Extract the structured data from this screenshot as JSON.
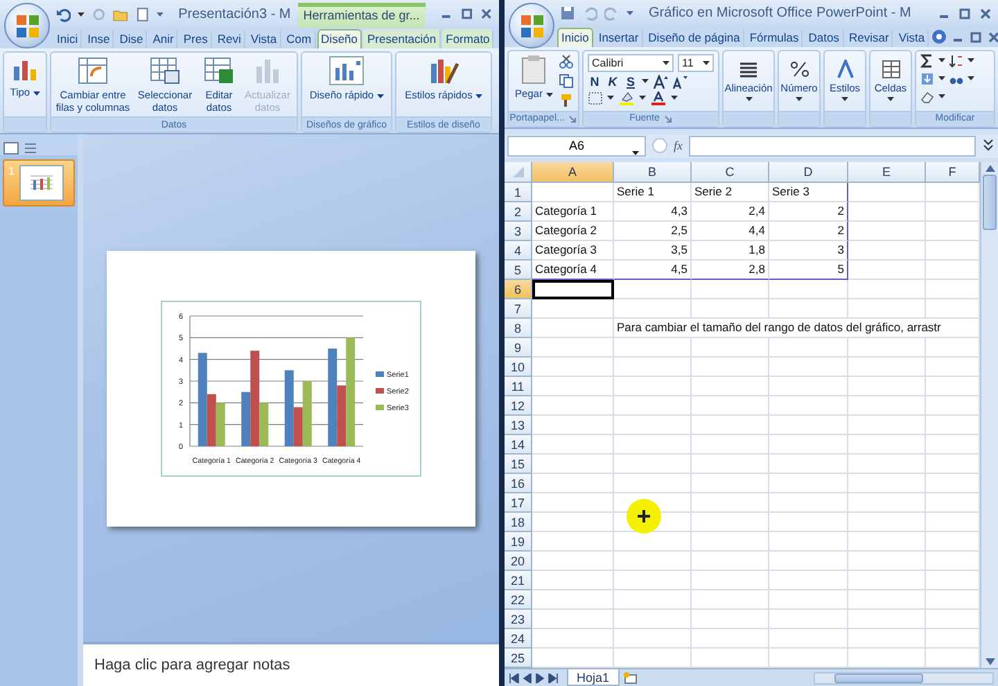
{
  "presentation_window": {
    "title": "Presentación3 - M",
    "context_label": "Herramientas de gr...",
    "tabs": [
      {
        "label": "Inici",
        "selected": false,
        "contextual": false
      },
      {
        "label": "Inse",
        "selected": false,
        "contextual": false
      },
      {
        "label": "Dise",
        "selected": false,
        "contextual": false
      },
      {
        "label": "Anir",
        "selected": false,
        "contextual": false
      },
      {
        "label": "Pres",
        "selected": false,
        "contextual": false
      },
      {
        "label": "Revi",
        "selected": false,
        "contextual": false
      },
      {
        "label": "Vista",
        "selected": false,
        "contextual": false
      },
      {
        "label": "Com",
        "selected": false,
        "contextual": false
      },
      {
        "label": "Diseño",
        "selected": true,
        "contextual": true
      },
      {
        "label": "Presentación",
        "selected": false,
        "contextual": true
      },
      {
        "label": "Formato",
        "selected": false,
        "contextual": true
      }
    ],
    "ribbon_groups": [
      {
        "buttons": [
          {
            "label": "Tipo",
            "dropdown": true,
            "disabled": false
          }
        ]
      },
      {
        "label": "Datos",
        "buttons": [
          {
            "label": "Cambiar entre filas y columnas",
            "dropdown": false,
            "disabled": false
          },
          {
            "label": "Seleccionar datos",
            "dropdown": false,
            "disabled": false
          },
          {
            "label": "Editar datos",
            "dropdown": false,
            "disabled": false
          },
          {
            "label": "Actualizar datos",
            "dropdown": false,
            "disabled": true
          }
        ]
      },
      {
        "label": "Diseños de gráfico",
        "buttons": [
          {
            "label": "Diseño rápido",
            "dropdown": true,
            "disabled": false
          }
        ]
      },
      {
        "label": "Estilos de diseño",
        "buttons": [
          {
            "label": "Estilos rápidos",
            "dropdown": true,
            "disabled": false
          }
        ]
      }
    ],
    "slide_thumbnails": [
      {
        "number": "1",
        "selected": true
      }
    ],
    "slide": {
      "chart_data": {
        "type": "bar",
        "categories": [
          "Categoría 1",
          "Categoría 2",
          "Categoría 3",
          "Categoría 4"
        ],
        "series": [
          {
            "name": "Serie1",
            "color": "#4f81bd",
            "values": [
              4.3,
              2.5,
              3.5,
              4.5
            ]
          },
          {
            "name": "Serie2",
            "color": "#c0504d",
            "values": [
              2.4,
              4.4,
              1.8,
              2.8
            ]
          },
          {
            "name": "Serie3",
            "color": "#9bbb59",
            "values": [
              2,
              2,
              3,
              5
            ]
          }
        ],
        "ylim": [
          0,
          6
        ],
        "yticks": [
          0,
          1,
          2,
          3,
          4,
          5,
          6
        ],
        "grid": true,
        "legend": "right"
      }
    },
    "notes": {
      "placeholder": "Haga clic para agregar notas"
    }
  },
  "workbook_window": {
    "title": "Gráfico en Microsoft Office PowerPoint - M",
    "tabs": [
      {
        "label": "Inicio",
        "selected": true
      },
      {
        "label": "Insertar",
        "selected": false
      },
      {
        "label": "Diseño de página",
        "selected": false
      },
      {
        "label": "Fórmulas",
        "selected": false
      },
      {
        "label": "Datos",
        "selected": false
      },
      {
        "label": "Revisar",
        "selected": false
      },
      {
        "label": "Vista",
        "selected": false
      }
    ],
    "clipboard": {
      "label": "Portapapel...",
      "paste": "Pegar"
    },
    "font": {
      "label": "Fuente",
      "name": "Calibri",
      "size": "11",
      "styles": [
        "N",
        "K",
        "S"
      ]
    },
    "commands": [
      {
        "label": "Alineación"
      },
      {
        "label": "Número"
      },
      {
        "label": "Estilos"
      },
      {
        "label": "Celdas"
      }
    ],
    "editing": {
      "label": "Modificar"
    },
    "name_box": "A6",
    "formula_label": "fx",
    "sheet": {
      "columns": [
        {
          "label": "A",
          "selected": true
        },
        {
          "label": "B",
          "selected": false
        },
        {
          "label": "C",
          "selected": false
        },
        {
          "label": "D",
          "selected": false
        },
        {
          "label": "E",
          "selected": false
        },
        {
          "label": "F",
          "selected": false
        }
      ],
      "rows": [
        {
          "number": "1",
          "kind": "label",
          "selected": false,
          "cells": [
            null,
            "Serie 1",
            "Serie 2",
            "Serie 3"
          ]
        },
        {
          "number": "2",
          "kind": "data",
          "selected": false,
          "cells": [
            "Categoría 1",
            "4,3",
            "2,4",
            "2"
          ]
        },
        {
          "number": "3",
          "kind": "data",
          "selected": false,
          "cells": [
            "Categoría 2",
            "2,5",
            "4,4",
            "2"
          ]
        },
        {
          "number": "4",
          "kind": "data",
          "selected": false,
          "cells": [
            "Categoría 3",
            "3,5",
            "1,8",
            "3"
          ]
        },
        {
          "number": "5",
          "kind": "data",
          "selected": false,
          "cells": [
            "Categoría 4",
            "4,5",
            "2,8",
            "5"
          ]
        },
        {
          "number": "6",
          "kind": "empty",
          "selected": true
        },
        {
          "number": "7",
          "kind": "empty",
          "selected": false
        },
        {
          "number": "8",
          "kind": "note",
          "selected": false,
          "cells": [
            null,
            "Para cambiar el tamaño del rango de datos del gráfico, arrastr"
          ]
        },
        {
          "number": "9",
          "kind": "empty",
          "selected": false
        },
        {
          "number": "10",
          "kind": "empty",
          "selected": false
        },
        {
          "number": "11",
          "kind": "empty",
          "selected": false
        },
        {
          "number": "12",
          "kind": "empty",
          "selected": false
        },
        {
          "number": "13",
          "kind": "empty",
          "selected": false
        },
        {
          "number": "14",
          "kind": "empty",
          "selected": false
        },
        {
          "number": "15",
          "kind": "empty",
          "selected": false
        },
        {
          "number": "16",
          "kind": "empty",
          "selected": false
        },
        {
          "number": "17",
          "kind": "empty",
          "selected": false
        },
        {
          "number": "18",
          "kind": "empty",
          "selected": false
        },
        {
          "number": "19",
          "kind": "empty",
          "selected": false
        },
        {
          "number": "20",
          "kind": "empty",
          "selected": false
        },
        {
          "number": "21",
          "kind": "empty",
          "selected": false
        },
        {
          "number": "22",
          "kind": "empty",
          "selected": false
        },
        {
          "number": "23",
          "kind": "empty",
          "selected": false
        },
        {
          "number": "24",
          "kind": "empty",
          "selected": false
        },
        {
          "number": "25",
          "kind": "empty",
          "selected": false
        }
      ]
    },
    "sheet_tabs": [
      {
        "label": "Hoja1",
        "selected": true
      }
    ]
  }
}
